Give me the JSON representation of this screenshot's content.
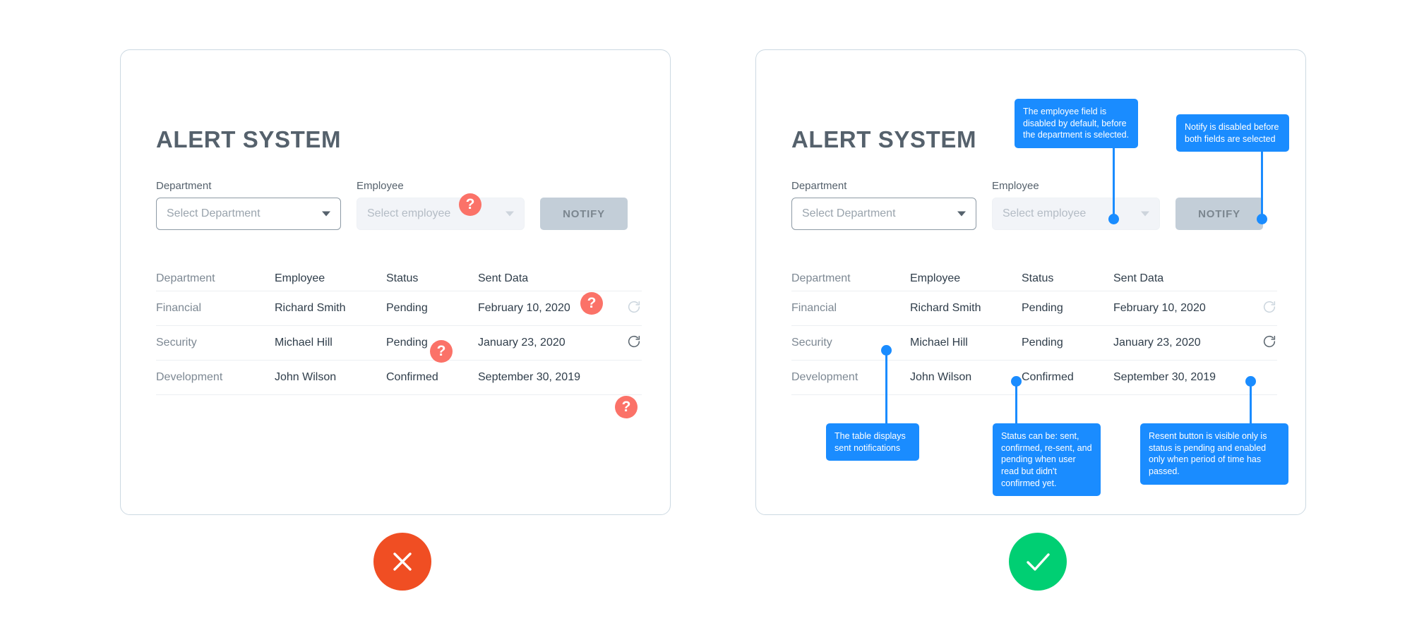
{
  "theme": {
    "page_bg": "#ffffff",
    "card_border": "#ccd9e2",
    "title_color": "#55616c",
    "tooltip_blue": "#1a8cff",
    "question_coral": "#fb7268",
    "bad_red": "#f04e23",
    "good_green": "#00cf73",
    "notify_disabled_bg": "#c3ced8"
  },
  "app": {
    "title": "ALERT SYSTEM",
    "form": {
      "department_label": "Department",
      "department_placeholder": "Select Department",
      "employee_label": "Employee",
      "employee_placeholder": "Select employee",
      "notify_label": "NOTIFY"
    },
    "table": {
      "columns": [
        "Department",
        "Employee",
        "Status",
        "Sent Data"
      ],
      "rows": [
        {
          "department": "Financial",
          "employee": "Richard Smith",
          "status": "Pending",
          "sent_data": "February 10, 2020",
          "resend_icon": "resend-icon",
          "resend_enabled": false
        },
        {
          "department": "Security",
          "employee": "Michael Hill",
          "status": "Pending",
          "sent_data": "January 23, 2020",
          "resend_icon": "resend-icon",
          "resend_enabled": true
        },
        {
          "department": "Development",
          "employee": "John Wilson",
          "status": "Confirmed",
          "sent_data": "September 30, 2019",
          "resend_icon": null,
          "resend_enabled": false
        }
      ]
    }
  },
  "bad_example": {
    "verdict_icon": "x-icon",
    "question_badges": [
      {
        "label": "?",
        "target": "employee-select"
      },
      {
        "label": "?",
        "target": "resend-button-row-1"
      },
      {
        "label": "?",
        "target": "status-column"
      },
      {
        "label": "?",
        "target": "table-bottom"
      }
    ]
  },
  "good_example": {
    "verdict_icon": "check-icon",
    "tooltips": [
      {
        "id": "employee-field-tip",
        "text": "The employee field is disabled by default, before the department is selected."
      },
      {
        "id": "notify-tip",
        "text": "Notify is disabled before both fields are selected"
      },
      {
        "id": "table-tip",
        "text": "The table displays sent notifications"
      },
      {
        "id": "status-tip",
        "text": "Status can be: sent, confirmed, re-sent, and pending when user read but didn't confirmed yet."
      },
      {
        "id": "resend-tip",
        "text": "Resent button is visible only is status is pending and enabled only when period of time has passed."
      }
    ]
  }
}
